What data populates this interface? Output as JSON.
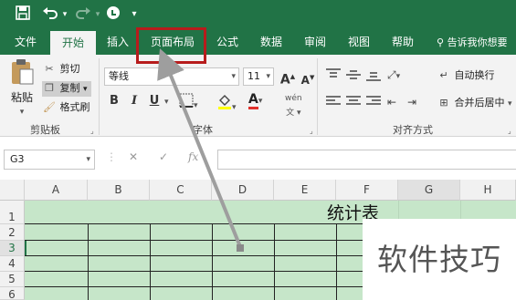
{
  "quick_access": {
    "save_icon": "save-icon",
    "undo_icon": "undo-icon",
    "redo_icon": "redo-icon",
    "touch_mode_icon": "touch-mode-icon",
    "customize_icon": "customize-icon"
  },
  "tabs": [
    {
      "label": "文件"
    },
    {
      "label": "开始"
    },
    {
      "label": "插入"
    },
    {
      "label": "页面布局"
    },
    {
      "label": "公式"
    },
    {
      "label": "数据"
    },
    {
      "label": "审阅"
    },
    {
      "label": "视图"
    },
    {
      "label": "帮助"
    }
  ],
  "active_tab": "开始",
  "tell_me": "告诉我你想要",
  "clipboard": {
    "paste": "粘贴",
    "cut": "剪切",
    "copy": "复制",
    "format_painter": "格式刷",
    "group": "剪贴板"
  },
  "font": {
    "name": "等线",
    "size": "11",
    "bold": "B",
    "italic": "I",
    "underline": "U",
    "group": "字体"
  },
  "alignment": {
    "wrap": "自动换行",
    "merge": "合并后居中",
    "group": "对齐方式"
  },
  "formula_bar": {
    "name_box": "G3",
    "fx": "fx",
    "value": ""
  },
  "grid": {
    "columns": [
      "A",
      "B",
      "C",
      "D",
      "E",
      "F",
      "G",
      "H"
    ],
    "selected_column": "G",
    "rows": [
      "1",
      "2",
      "3",
      "4",
      "5",
      "6"
    ],
    "selected_row": "3",
    "title_text": "统计表"
  },
  "watermark": "软件技巧",
  "colors": {
    "ribbon_green": "#217346",
    "cell_fill": "#c6e6c9",
    "highlight_box": "#b71c1c",
    "arrow": "#9e9e9e"
  }
}
